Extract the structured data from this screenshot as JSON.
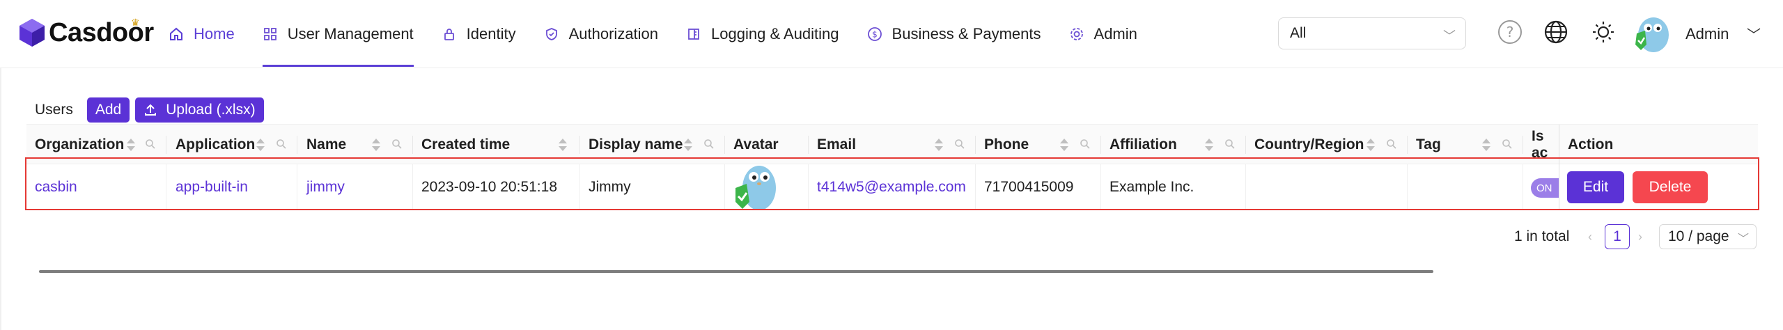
{
  "app": {
    "name": "Casdoor"
  },
  "nav": {
    "items": [
      {
        "label": "Home",
        "icon": "home-icon"
      },
      {
        "label": "User Management",
        "icon": "grid-icon"
      },
      {
        "label": "Identity",
        "icon": "lock-icon"
      },
      {
        "label": "Authorization",
        "icon": "shield-icon"
      },
      {
        "label": "Logging & Auditing",
        "icon": "log-icon"
      },
      {
        "label": "Business & Payments",
        "icon": "dollar-icon"
      },
      {
        "label": "Admin",
        "icon": "gear-icon"
      }
    ]
  },
  "header": {
    "org_select": "All",
    "user_name": "Admin"
  },
  "toolbar": {
    "title": "Users",
    "add_label": "Add",
    "upload_label": "Upload (.xlsx)"
  },
  "table": {
    "columns": [
      "Organization",
      "Application",
      "Name",
      "Created time",
      "Display name",
      "Avatar",
      "Email",
      "Phone",
      "Affiliation",
      "Country/Region",
      "Tag",
      "Is ac",
      "Action"
    ],
    "row": {
      "organization": "casbin",
      "application": "app-built-in",
      "name": "jimmy",
      "created_time": "2023-09-10 20:51:18",
      "display_name": "Jimmy",
      "email": "t414w5@example.com",
      "phone": "71700415009",
      "affiliation": "Example Inc.",
      "country": "",
      "tag": "",
      "toggle": "ON",
      "edit_label": "Edit",
      "delete_label": "Delete"
    }
  },
  "pagination": {
    "total": "1 in total",
    "current": "1",
    "page_size": "10 / page"
  },
  "colors": {
    "accent": "#5b32d6",
    "danger": "#f5474f",
    "highlight": "#e53935"
  }
}
